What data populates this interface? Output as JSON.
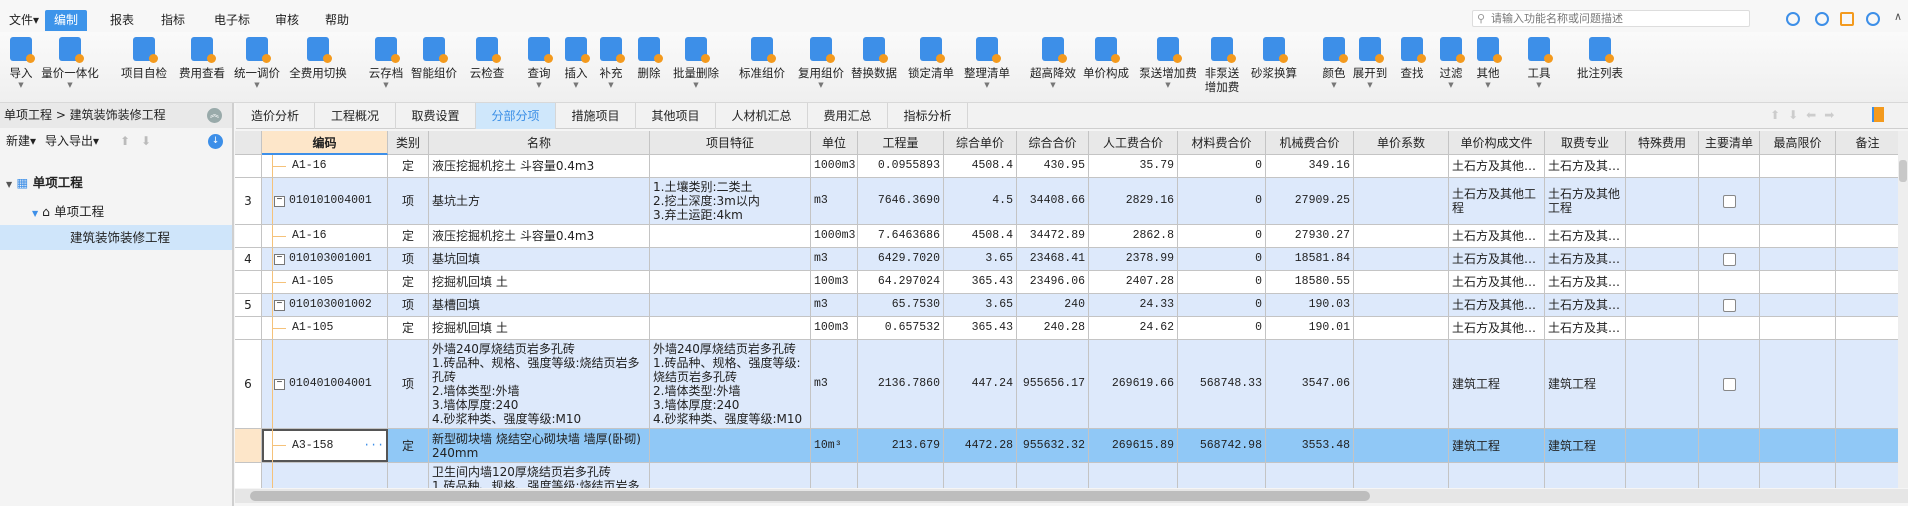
{
  "menu": {
    "items": [
      "文件▾",
      "编制",
      "报表",
      "指标",
      "电子标",
      "审核",
      "帮助"
    ],
    "active_index": 1,
    "search_placeholder": "请输入功能名称或问题描述"
  },
  "toolbar": {
    "buttons": [
      {
        "label": "导入",
        "dropdown": true
      },
      {
        "label": "量价一体化",
        "dropdown": true
      },
      {
        "label": "项目自检"
      },
      {
        "label": "费用查看"
      },
      {
        "label": "统一调价",
        "dropdown": true
      },
      {
        "label": "全费用切换"
      },
      {
        "label": "云存档",
        "dropdown": true
      },
      {
        "label": "智能组价"
      },
      {
        "label": "云检查"
      },
      {
        "label": "查询",
        "dropdown": true
      },
      {
        "label": "插入",
        "dropdown": true
      },
      {
        "label": "补充",
        "dropdown": true
      },
      {
        "label": "删除"
      },
      {
        "label": "批量删除",
        "dropdown": true
      },
      {
        "label": "标准组价"
      },
      {
        "label": "复用组价",
        "dropdown": true
      },
      {
        "label": "替换数据"
      },
      {
        "label": "锁定清单"
      },
      {
        "label": "整理清单",
        "dropdown": true
      },
      {
        "label": "超高降效",
        "dropdown": true
      },
      {
        "label": "单价构成"
      },
      {
        "label": "泵送增加费",
        "dropdown": true
      },
      {
        "label": "非泵送\n增加费"
      },
      {
        "label": "砂浆换算"
      },
      {
        "label": "颜色",
        "dropdown": true
      },
      {
        "label": "展开到",
        "dropdown": true
      },
      {
        "label": "查找"
      },
      {
        "label": "过滤",
        "dropdown": true
      },
      {
        "label": "其他",
        "dropdown": true
      },
      {
        "label": "工具",
        "dropdown": true
      },
      {
        "label": "批注列表"
      }
    ]
  },
  "left_panel": {
    "breadcrumb": "单项工程 > 建筑装饰装修工程",
    "new_label": "新建▾",
    "import_export_label": "导入导出▾",
    "tree": [
      {
        "label": "单项工程",
        "level": 0
      },
      {
        "label": "单项工程",
        "level": 1
      },
      {
        "label": "建筑装饰装修工程",
        "level": 2,
        "selected": true
      }
    ]
  },
  "tabs": {
    "items": [
      "造价分析",
      "工程概况",
      "取费设置",
      "分部分项",
      "措施项目",
      "其他项目",
      "人材机汇总",
      "费用汇总",
      "指标分析"
    ],
    "active_index": 3
  },
  "grid": {
    "columns": [
      "",
      "编码",
      "类别",
      "名称",
      "项目特征",
      "单位",
      "工程量",
      "综合单价",
      "综合合价",
      "人工费合价",
      "材料费合价",
      "机械费合价",
      "单价系数",
      "单价构成文件",
      "取费专业",
      "特殊费用",
      "主要清单",
      "最高限价",
      "备注"
    ],
    "rows": [
      {
        "kind": "定",
        "no": "",
        "code": "A1-16",
        "type": "定",
        "name": "液压挖掘机挖土 斗容量0.4m3",
        "feature": "",
        "unit": "1000m3",
        "qty": "0.0955893",
        "unit_price": "4508.4",
        "total": "430.95",
        "labor": "35.79",
        "material": "0",
        "machine": "349.16",
        "coef": "",
        "file": "土石方及其他…",
        "specialty": "土石方及其…",
        "special": "",
        "main": null,
        "max": "",
        "note": ""
      },
      {
        "kind": "项",
        "no": "3",
        "code": "010101004001",
        "type": "项",
        "name": "基坑土方",
        "feature": "1.土壤类别:二类土\n2.挖土深度:3m以内\n3.弃土运距:4km",
        "unit": "m3",
        "qty": "7646.3690",
        "unit_price": "4.5",
        "total": "34408.66",
        "labor": "2829.16",
        "material": "0",
        "machine": "27909.25",
        "coef": "",
        "file": "土石方及其他工程",
        "specialty": "土石方及其他工程",
        "special": "",
        "main": false,
        "max": "",
        "note": ""
      },
      {
        "kind": "定",
        "no": "",
        "code": "A1-16",
        "type": "定",
        "name": "液压挖掘机挖土 斗容量0.4m3",
        "feature": "",
        "unit": "1000m3",
        "qty": "7.6463686",
        "unit_price": "4508.4",
        "total": "34472.89",
        "labor": "2862.8",
        "material": "0",
        "machine": "27930.27",
        "coef": "",
        "file": "土石方及其他…",
        "specialty": "土石方及其…",
        "special": "",
        "main": null,
        "max": "",
        "note": ""
      },
      {
        "kind": "项",
        "no": "4",
        "code": "010103001001",
        "type": "项",
        "name": "基坑回填",
        "feature": "",
        "unit": "m3",
        "qty": "6429.7020",
        "unit_price": "3.65",
        "total": "23468.41",
        "labor": "2378.99",
        "material": "0",
        "machine": "18581.84",
        "coef": "",
        "file": "土石方及其他…",
        "specialty": "土石方及其…",
        "special": "",
        "main": false,
        "max": "",
        "note": ""
      },
      {
        "kind": "定",
        "no": "",
        "code": "A1-105",
        "type": "定",
        "name": "挖掘机回填 土",
        "feature": "",
        "unit": "100m3",
        "qty": "64.297024",
        "unit_price": "365.43",
        "total": "23496.06",
        "labor": "2407.28",
        "material": "0",
        "machine": "18580.55",
        "coef": "",
        "file": "土石方及其他…",
        "specialty": "土石方及其…",
        "special": "",
        "main": null,
        "max": "",
        "note": ""
      },
      {
        "kind": "项",
        "no": "5",
        "code": "010103001002",
        "type": "项",
        "name": "基槽回填",
        "feature": "",
        "unit": "m3",
        "qty": "65.7530",
        "unit_price": "3.65",
        "total": "240",
        "labor": "24.33",
        "material": "0",
        "machine": "190.03",
        "coef": "",
        "file": "土石方及其他…",
        "specialty": "土石方及其…",
        "special": "",
        "main": false,
        "max": "",
        "note": ""
      },
      {
        "kind": "定",
        "no": "",
        "code": "A1-105",
        "type": "定",
        "name": "挖掘机回填 土",
        "feature": "",
        "unit": "100m3",
        "qty": "0.657532",
        "unit_price": "365.43",
        "total": "240.28",
        "labor": "24.62",
        "material": "0",
        "machine": "190.01",
        "coef": "",
        "file": "土石方及其他…",
        "specialty": "土石方及其…",
        "special": "",
        "main": null,
        "max": "",
        "note": ""
      },
      {
        "kind": "项",
        "no": "6",
        "code": "010401004001",
        "type": "项",
        "name": "外墙240厚烧结页岩多孔砖\n1.砖品种、规格、强度等级:烧结页岩多孔砖\n2.墙体类型:外墙\n3.墙体厚度:240\n4.砂浆种类、强度等级:M10",
        "feature": "外墙240厚烧结页岩多孔砖\n1.砖品种、规格、强度等级:烧结页岩多孔砖\n2.墙体类型:外墙\n3.墙体厚度:240\n4.砂浆种类、强度等级:M10",
        "unit": "m3",
        "qty": "2136.7860",
        "unit_price": "447.24",
        "total": "955656.17",
        "labor": "269619.66",
        "material": "568748.33",
        "machine": "3547.06",
        "coef": "",
        "file": "建筑工程",
        "specialty": "建筑工程",
        "special": "",
        "main": false,
        "max": "",
        "note": ""
      },
      {
        "kind": "定",
        "selected": true,
        "no": "",
        "code": "A3-158",
        "type": "定",
        "name": "新型砌块墙 烧结空心砌块墙 墙厚(卧砌)\n240mm",
        "feature": "",
        "unit": "10m³",
        "qty": "213.679",
        "unit_price": "4472.28",
        "total": "955632.32",
        "labor": "269615.89",
        "material": "568742.98",
        "machine": "3553.48",
        "coef": "",
        "file": "建筑工程",
        "specialty": "建筑工程",
        "special": "",
        "main": null,
        "max": "",
        "note": ""
      },
      {
        "kind": "项",
        "no": "",
        "code": "",
        "type": "",
        "name": "卫生间内墙120厚烧结页岩多孔砖\n1.砖品种、规格、强度等级:烧结页岩多",
        "feature": "",
        "unit": "",
        "qty": "",
        "unit_price": "",
        "total": "",
        "labor": "",
        "material": "",
        "machine": "",
        "coef": "",
        "file": "",
        "specialty": "",
        "special": "",
        "main": null,
        "max": "",
        "note": ""
      }
    ]
  },
  "colors": {
    "accent": "#3d94ea",
    "row_item": "#dde9fb",
    "row_selected": "#90c8f6",
    "header": "#e8e8e8",
    "key_header": "#fde6c9"
  }
}
